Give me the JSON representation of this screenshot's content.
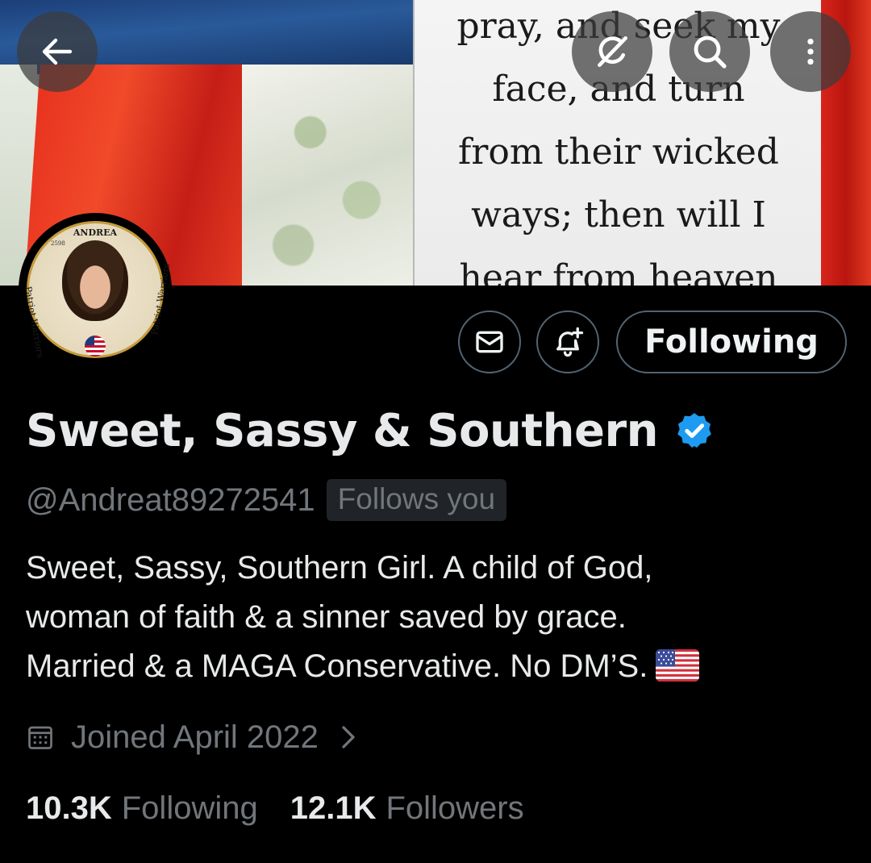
{
  "banner": {
    "verse_lines": "pray, and seek my\nface, and turn\nfrom their wicked\nways; then will I\nhear from heaven"
  },
  "topbar": {
    "back_icon": "arrow-left-icon",
    "grok_icon": "grok-icon",
    "search_icon": "search-icon",
    "more_icon": "more-vertical-icon"
  },
  "avatar": {
    "badge_name": "ANDREA",
    "badge_number": "2598",
    "ring_text_left": "Patriot Warriors",
    "ring_text_right": "Patriot Warriors"
  },
  "actions": {
    "message_icon": "mail-icon",
    "notify_icon": "bell-plus-icon",
    "following_label": "Following"
  },
  "profile": {
    "display_name": "Sweet, Sassy & Southern",
    "verified": true,
    "verified_color": "#1d9bf0",
    "handle": "@Andreat89272541",
    "follows_you": "Follows you",
    "bio_lines": [
      "Sweet, Sassy, Southern Girl. A child of God,",
      "woman of faith & a sinner saved by grace.",
      "Married & a MAGA Conservative. No DM’S."
    ],
    "bio_emoji": "us-flag",
    "joined": "Joined April 2022",
    "joined_icon": "calendar-icon"
  },
  "stats": {
    "following_count": "10.3K",
    "following_label": "Following",
    "followers_count": "12.1K",
    "followers_label": "Followers"
  }
}
